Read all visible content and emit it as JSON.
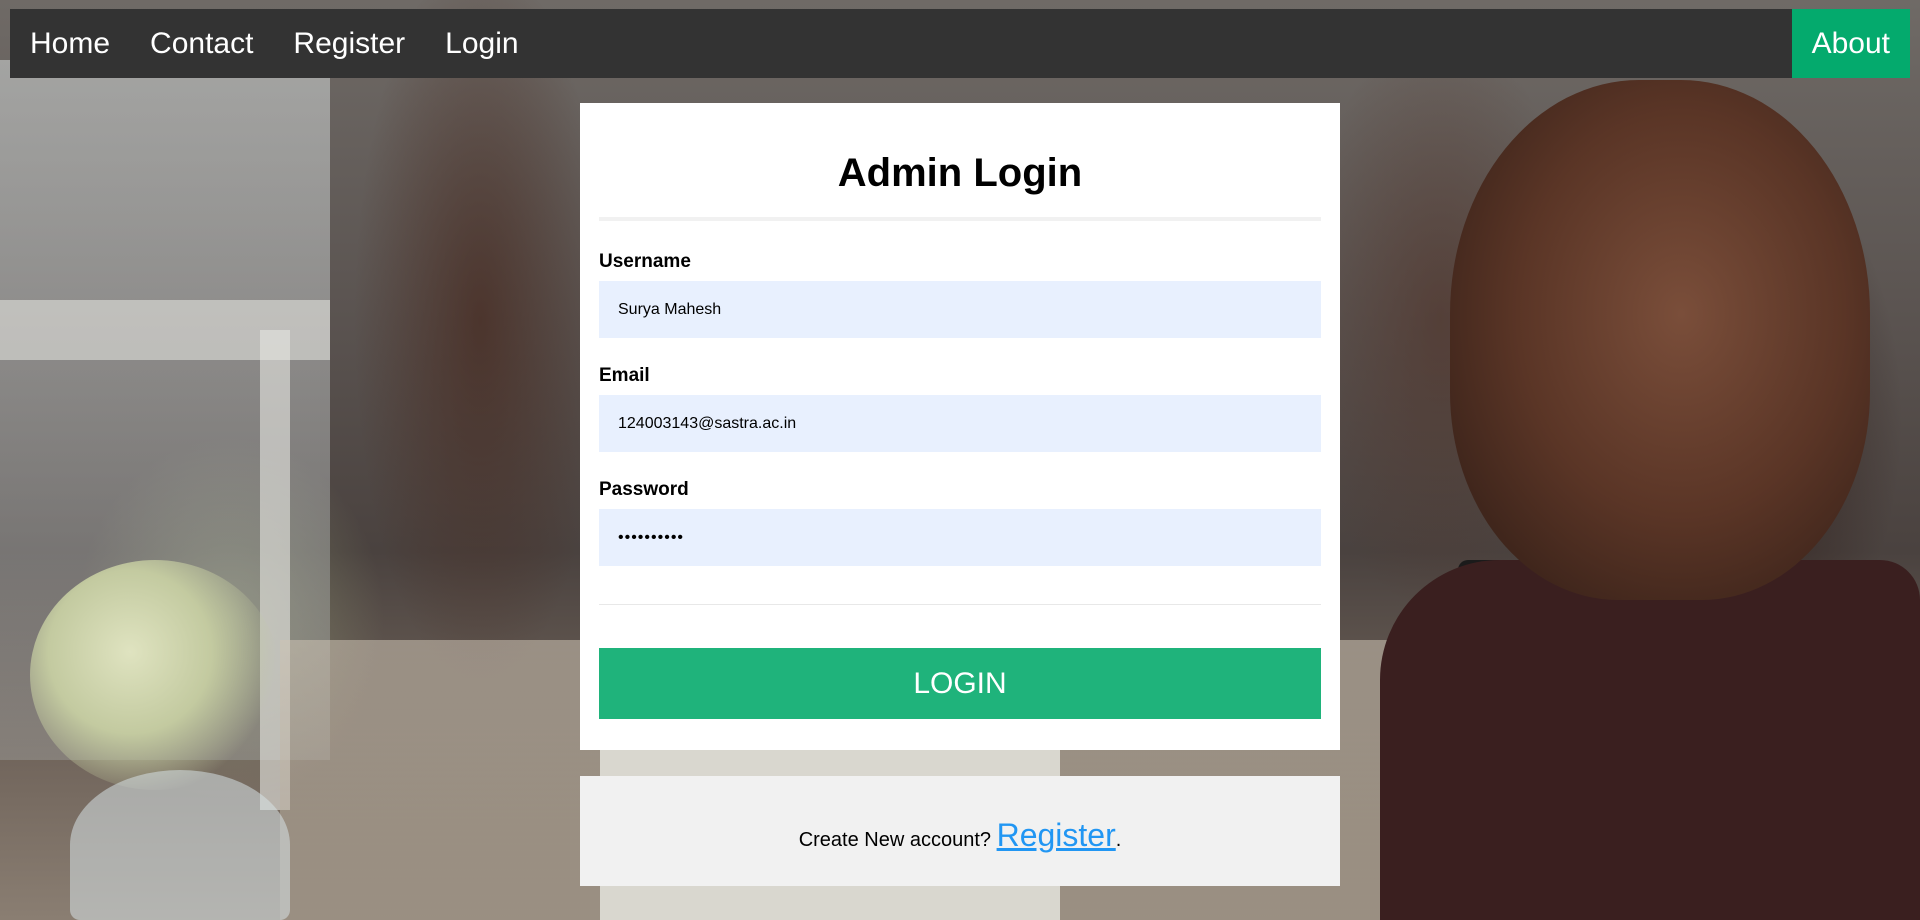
{
  "nav": {
    "home": "Home",
    "contact": "Contact",
    "register": "Register",
    "login": "Login",
    "about": "About"
  },
  "login_form": {
    "title": "Admin Login",
    "username_label": "Username",
    "username_value": "Surya Mahesh",
    "email_label": "Email",
    "email_value": "124003143@sastra.ac.in",
    "password_label": "Password",
    "password_value": "••••••••••",
    "submit_label": "LOGIN"
  },
  "footer": {
    "prompt_text": "Create New account? ",
    "register_link": "Register",
    "period": "."
  },
  "colors": {
    "navbar_bg": "#333333",
    "about_bg": "#04aa6d",
    "input_bg": "#e8f0fe",
    "login_button_bg": "#1fb37b",
    "footer_bg": "#f1f1f1",
    "link_color": "#2196f3"
  }
}
